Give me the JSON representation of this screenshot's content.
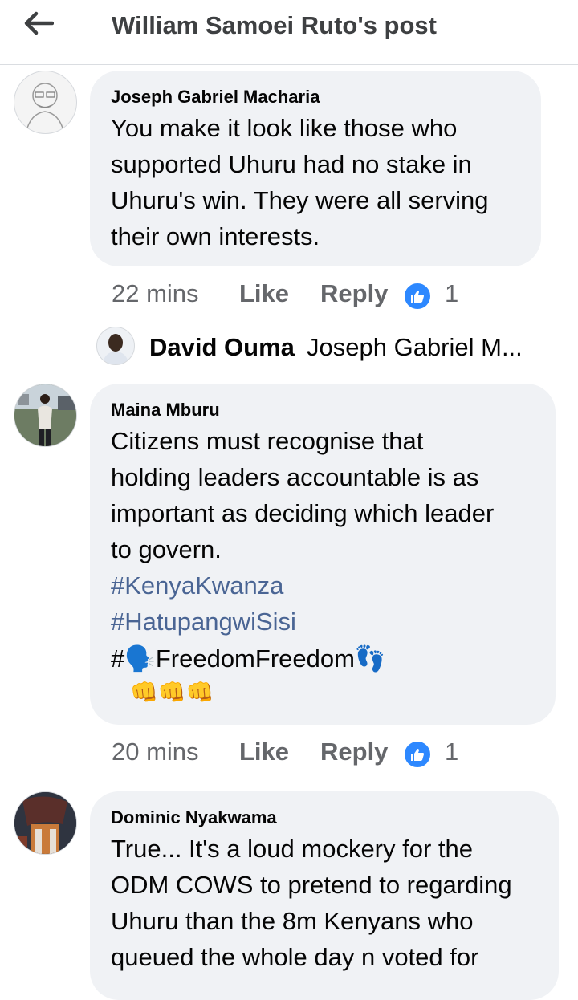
{
  "header": {
    "title": "William Samoei Ruto's post"
  },
  "comments": [
    {
      "author": "Joseph Gabriel Macharia",
      "lines": [
        "You make it look like those who",
        "supported Uhuru had no stake in",
        "Uhuru's win. They were all serving",
        "their own interests."
      ],
      "time": "22 mins",
      "like_label": "Like",
      "reply_label": "Reply",
      "reaction_count": "1"
    },
    {
      "author": "Maina Mburu",
      "lines": [
        "Citizens must recognise that",
        "holding leaders accountable is as",
        "important as deciding which leader",
        "to govern."
      ],
      "hashtags": [
        "#KenyaKwanza",
        "#HatupangwiSisi"
      ],
      "freedom_line": "#🗣️FreedomFreedom👣",
      "emoji_line": "👊👊👊",
      "time": "20 mins",
      "like_label": "Like",
      "reply_label": "Reply",
      "reaction_count": "1"
    },
    {
      "author": "Dominic Nyakwama",
      "lines": [
        "True... It's a loud mockery for the",
        "ODM COWS to pretend to regarding",
        "Uhuru than the 8m Kenyans who",
        "queued the whole day n voted for"
      ]
    }
  ],
  "reply_preview": {
    "name": "David Ouma",
    "snippet": "Joseph Gabriel M..."
  },
  "colors": {
    "bubble": "#f0f2f5",
    "meta_text": "#65676b",
    "hashtag": "#4a6594",
    "like_blue": "#2d88ff"
  }
}
